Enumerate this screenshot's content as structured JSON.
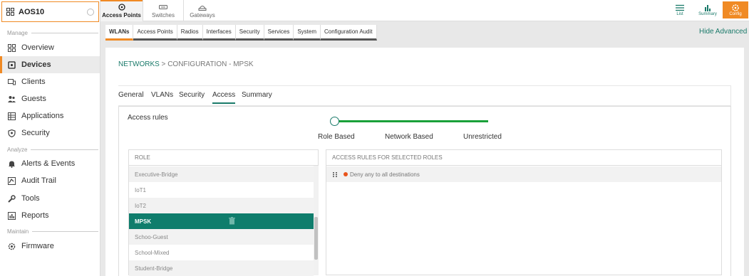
{
  "sidebar": {
    "group_name": "AOS10",
    "sections": {
      "manage": "Manage",
      "analyze": "Analyze",
      "maintain": "Maintain"
    },
    "items": [
      {
        "label": "Overview",
        "icon": "grid-icon"
      },
      {
        "label": "Devices",
        "icon": "devices-icon"
      },
      {
        "label": "Clients",
        "icon": "clients-icon"
      },
      {
        "label": "Guests",
        "icon": "guests-icon"
      },
      {
        "label": "Applications",
        "icon": "applications-icon"
      },
      {
        "label": "Security",
        "icon": "shield-icon"
      },
      {
        "label": "Alerts & Events",
        "icon": "bell-icon"
      },
      {
        "label": "Audit Trail",
        "icon": "audit-icon"
      },
      {
        "label": "Tools",
        "icon": "wrench-icon"
      },
      {
        "label": "Reports",
        "icon": "report-icon"
      },
      {
        "label": "Firmware",
        "icon": "gear-icon"
      }
    ],
    "active_item": "Devices"
  },
  "topnav": {
    "tabs": [
      {
        "label": "Access Points",
        "icon": "access-point-icon"
      },
      {
        "label": "Switches",
        "icon": "switch-icon"
      },
      {
        "label": "Gateways",
        "icon": "gateway-icon"
      }
    ],
    "active_tab": "Access Points",
    "views": [
      {
        "label": "List",
        "icon": "list-icon"
      },
      {
        "label": "Summary",
        "icon": "bar-chart-icon"
      },
      {
        "label": "Config",
        "icon": "gear-icon"
      }
    ],
    "active_view": "Config"
  },
  "subtabs": {
    "items": [
      "WLANs",
      "Access Points",
      "Radios",
      "Interfaces",
      "Security",
      "Services",
      "System",
      "Configuration Audit"
    ],
    "active": "WLANs",
    "hide_advanced": "Hide Advanced"
  },
  "breadcrumb": {
    "link": "NETWORKS",
    "separator": " > ",
    "current": "CONFIGURATION - MPSK"
  },
  "wizard_tabs": {
    "items": [
      "General",
      "VLANs",
      "Security",
      "Access",
      "Summary"
    ],
    "active": "Access"
  },
  "access": {
    "label": "Access rules",
    "slider_options": [
      "Role Based",
      "Network Based",
      "Unrestricted"
    ],
    "slider_selected": "Role Based"
  },
  "roles": {
    "header": "ROLE",
    "items": [
      "Executive-Bridge",
      "IoT1",
      "IoT2",
      "MPSK",
      "Schoo-Guest",
      "School-Mixed",
      "Student-Bridge"
    ],
    "selected": "MPSK"
  },
  "rules": {
    "header": "ACCESS RULES FOR SELECTED ROLES",
    "items": [
      {
        "text": "Deny any to all destinations",
        "status_color": "#e8541c"
      }
    ]
  },
  "colors": {
    "accent": "#f08a24",
    "teal": "#0f7d6c",
    "slider_green": "#1aa039"
  }
}
